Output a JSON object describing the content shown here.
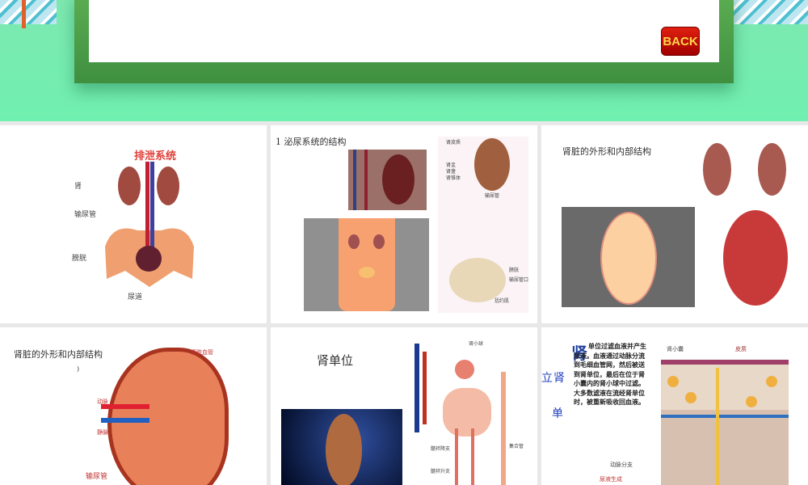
{
  "header": {
    "back_button": "BACK"
  },
  "slides": [
    {
      "title": "排泄系统",
      "labels": [
        "肾",
        "输尿管",
        "膀胱",
        "尿道"
      ]
    },
    {
      "title": "1 泌尿系统的结构",
      "labels": [
        "肾皮质",
        "肾盂",
        "肾盏",
        "肾锥体",
        "输尿管",
        "膀胱",
        "输尿管口",
        "括约肌"
      ]
    },
    {
      "title": "肾脏的外形和内部结构"
    },
    {
      "title": "肾脏的外形和内部结构",
      "labels": [
        "肾脏血管",
        "动脉",
        "静脉",
        "输尿管"
      ],
      "extra": ")"
    },
    {
      "title": "肾单位",
      "labels": [
        "肾小球",
        "髓袢降支",
        "髓袢升支",
        "集合管"
      ]
    },
    {
      "side_title": [
        "立",
        "肾",
        "单"
      ],
      "big_char": "肾",
      "paragraph": "单位过滤血液并产生尿液。血液通过动脉分流到毛细血管网，然后被送到肾单位，最后在位于肾小囊内的肾小球中过滤。大多数滤液在流经肾单位时，被重新吸收回血液。",
      "labels": [
        "肾小囊",
        "皮质",
        "动脉分支",
        "尿液生成"
      ]
    }
  ]
}
